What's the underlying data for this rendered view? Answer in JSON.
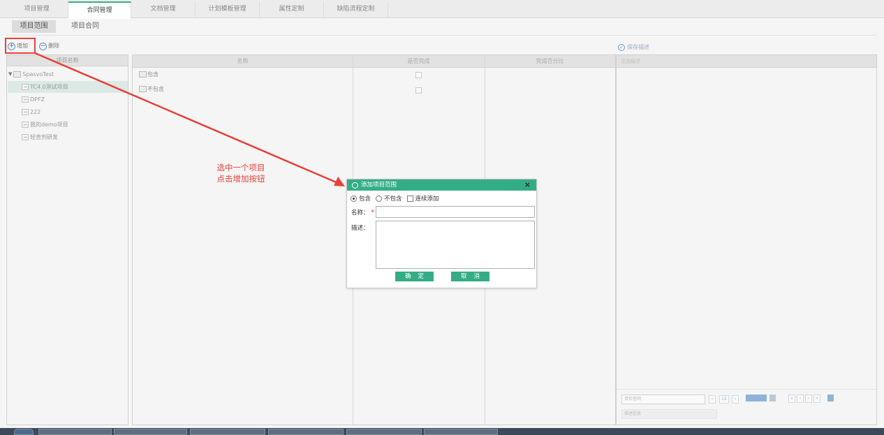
{
  "top_tabs": [
    "项目管理",
    "合同管理",
    "文档管理",
    "计划模板管理",
    "属性定制",
    "缺陷流程定制"
  ],
  "sub_tabs": [
    "项目范围",
    "项目合同"
  ],
  "toolbar": {
    "add_label": "增加",
    "delete_label": "删除",
    "save_desc_label": "保存描述"
  },
  "tree": {
    "header": "项目名称",
    "root": "SpasvoTest",
    "items": [
      "TC4.0测试项目",
      "DPFZ",
      "222",
      "我的demo项目",
      "轻舍剂研发"
    ]
  },
  "grid": {
    "headers": [
      "名称",
      "是否完成",
      "完成百分比"
    ],
    "rows": [
      {
        "name": "包含"
      },
      {
        "name": "不包含"
      }
    ]
  },
  "right_panel": {
    "header": "范围描述",
    "pager_input": "请检查网",
    "pager_count": "12",
    "pager_secondary": "描述信息"
  },
  "annotation": {
    "line1": "选中一个项目",
    "line2": "点击增加按钮"
  },
  "dialog": {
    "title": "添加项目范围",
    "close": "×",
    "radio_include": "包含",
    "radio_exclude": "不包含",
    "continuous_add": "连续添加",
    "name_label": "名称：",
    "required_mark": "*",
    "desc_label": "描述：",
    "confirm": "确定",
    "cancel": "取消"
  },
  "colors": {
    "accent": "#34ad87",
    "annotation": "#e8403a"
  }
}
